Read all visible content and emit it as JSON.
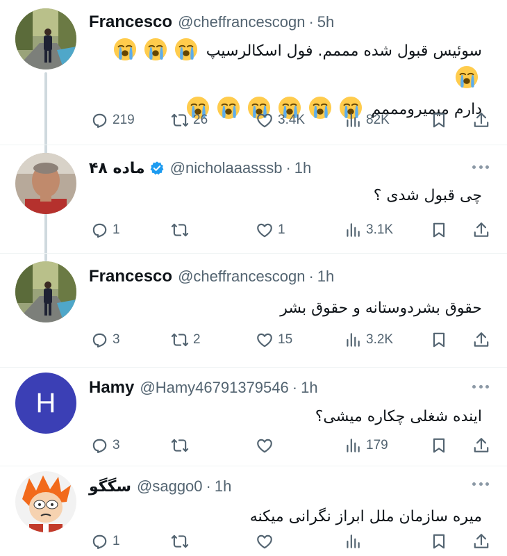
{
  "tweets": [
    {
      "name": "Francesco",
      "handle": "@cheffrancescogn",
      "separator": "·",
      "time": "5h",
      "verified": false,
      "avatar": "photo-man-standing-street",
      "line1": "سوئیس قبول شده مممم. فول اسکالرسیپ",
      "line2": "دارم میمیرومممم",
      "emoji": "loudly-crying-face",
      "stats": {
        "replies": "219",
        "retweets": "26",
        "likes": "3.4K",
        "views": "82K"
      }
    },
    {
      "name": "ماده ۴۸",
      "handle": "@nicholaaasssb",
      "separator": "·",
      "time": "1h",
      "verified": true,
      "avatar": "photo-man-selfie",
      "line1": "چی قبول شدی ؟",
      "stats": {
        "replies": "1",
        "retweets": "",
        "likes": "1",
        "views": "3.1K"
      }
    },
    {
      "name": "Francesco",
      "handle": "@cheffrancescogn",
      "separator": "·",
      "time": "1h",
      "verified": false,
      "avatar": "photo-man-standing-street",
      "line1": "حقوق بشردوستانه و حقوق بشر",
      "stats": {
        "replies": "3",
        "retweets": "2",
        "likes": "15",
        "views": "3.2K"
      }
    },
    {
      "name": "Hamy",
      "handle": "@Hamy46791379546",
      "separator": "·",
      "time": "1h",
      "verified": false,
      "avatar_letter": "H",
      "avatar_color": "#3b3fb5",
      "line1": "اینده شغلی چکاره میشی؟",
      "stats": {
        "replies": "3",
        "retweets": "",
        "likes": "",
        "views": "179"
      }
    },
    {
      "name": "سگگو",
      "handle": "@saggo0",
      "separator": "·",
      "time": "1h",
      "verified": false,
      "avatar": "cartoon-fry",
      "line1": "میره سازمان ملل ابراز نگرانی میکنه",
      "stats": {
        "replies": "1",
        "retweets": "",
        "likes": "",
        "views": ""
      }
    }
  ],
  "icons": [
    "reply-icon",
    "retweet-icon",
    "like-icon",
    "views-icon",
    "bookmark-icon",
    "share-icon",
    "more-icon",
    "verified-icon"
  ],
  "colors": {
    "text": "#0f1419",
    "secondary": "#536471",
    "verified": "#1d9bf0",
    "thread_line": "#cfd9de"
  }
}
